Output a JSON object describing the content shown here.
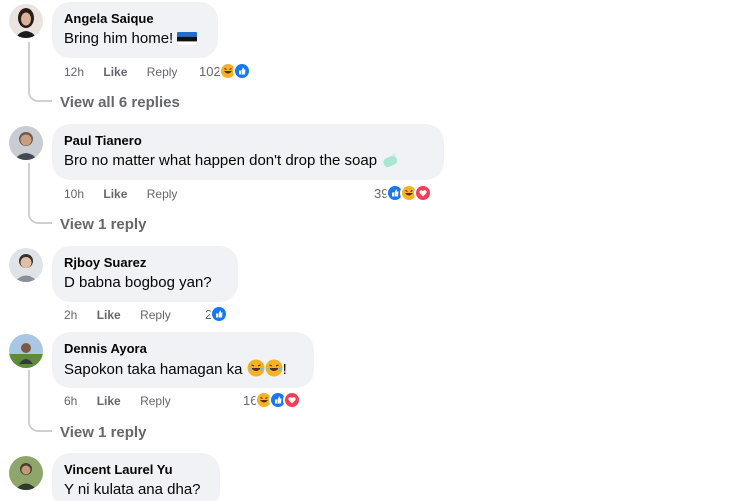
{
  "comments": [
    {
      "name": "Angela Saique",
      "text": "Bring him home!",
      "time": "12h",
      "like": "Like",
      "reply": "Reply",
      "reaction_count": "102",
      "reactions": [
        "haha-icon",
        "like-icon"
      ]
    },
    {
      "name": "Paul Tianero",
      "text": "Bro no matter what happen don't drop the soap",
      "time": "10h",
      "like": "Like",
      "reply": "Reply",
      "reaction_count": "39",
      "reactions": [
        "like-icon",
        "haha-icon",
        "love-icon"
      ]
    },
    {
      "name": "Rjboy Suarez",
      "text": "D babna bogbog yan?",
      "time": "2h",
      "like": "Like",
      "reply": "Reply",
      "reaction_count": "2",
      "reactions": [
        "like-icon"
      ]
    },
    {
      "name": "Dennis Ayora",
      "text": "Sapokon taka hamagan ka",
      "text_suffix": "!",
      "time": "6h",
      "like": "Like",
      "reply": "Reply",
      "reaction_count": "16",
      "reactions": [
        "haha-icon",
        "like-icon",
        "love-icon"
      ]
    },
    {
      "name": "Vincent Laurel Yu",
      "text": "Y ni kulata ana dha?"
    }
  ],
  "replies": {
    "angela": "View all 6 replies",
    "paul": "View 1 reply",
    "dennis": "View 1 reply"
  },
  "colors": {
    "like": "#1877f2",
    "love": "#f33e58",
    "haha": "#f7b125",
    "bubble": "#f0f2f5",
    "meta": "#65676b"
  }
}
